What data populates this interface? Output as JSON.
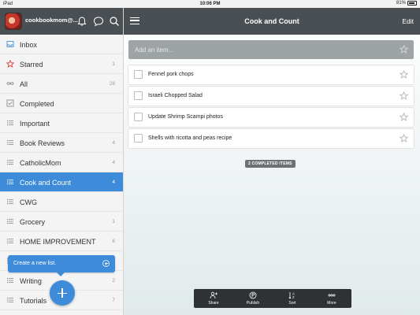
{
  "status_bar": {
    "carrier": "iPad",
    "time": "10:06 PM",
    "battery": "81%"
  },
  "sidebar": {
    "user_name": "cookbookmom@...",
    "items": [
      {
        "label": "Inbox",
        "count": "",
        "icon": "inbox-icon"
      },
      {
        "label": "Starred",
        "count": "1",
        "icon": "star-icon"
      },
      {
        "label": "All",
        "count": "28",
        "icon": "infinity-icon"
      },
      {
        "label": "Completed",
        "count": "",
        "icon": "check-box-icon"
      },
      {
        "label": "Important",
        "count": "",
        "icon": "list-icon"
      },
      {
        "label": "Book Reviews",
        "count": "4",
        "icon": "list-icon"
      },
      {
        "label": "CatholicMom",
        "count": "4",
        "icon": "list-icon"
      },
      {
        "label": "Cook and Count",
        "count": "4",
        "icon": "list-icon",
        "active": true
      },
      {
        "label": "CWG",
        "count": "",
        "icon": "list-icon"
      },
      {
        "label": "Grocery",
        "count": "1",
        "icon": "list-icon"
      },
      {
        "label": "HOME IMPROVEMENT",
        "count": "6",
        "icon": "list-icon"
      },
      {
        "label": "",
        "count": "",
        "icon": "list-icon"
      },
      {
        "label": "Writing",
        "count": "2",
        "icon": "list-icon"
      },
      {
        "label": "Tutorials",
        "count": "7",
        "icon": "list-icon"
      }
    ],
    "tooltip": "Create a new list."
  },
  "main": {
    "title": "Cook and Count",
    "edit_label": "Edit",
    "add_placeholder": "Add an item...",
    "tasks": [
      "Fennel pork chops",
      "Israeli Chopped Salad",
      "Update Shrimp Scampi photos",
      "Shells with ricotta and peas recipe"
    ],
    "completed_label": "2 COMPLETED ITEMS",
    "toolbar": [
      {
        "label": "Share",
        "icon": "share-icon"
      },
      {
        "label": "Publish",
        "icon": "publish-icon"
      },
      {
        "label": "Sort",
        "icon": "sort-icon"
      },
      {
        "label": "More",
        "icon": "more-icon"
      }
    ]
  },
  "colors": {
    "accent": "#3d8bd9",
    "header": "#4a4f54",
    "toolbar": "#2e3235"
  }
}
